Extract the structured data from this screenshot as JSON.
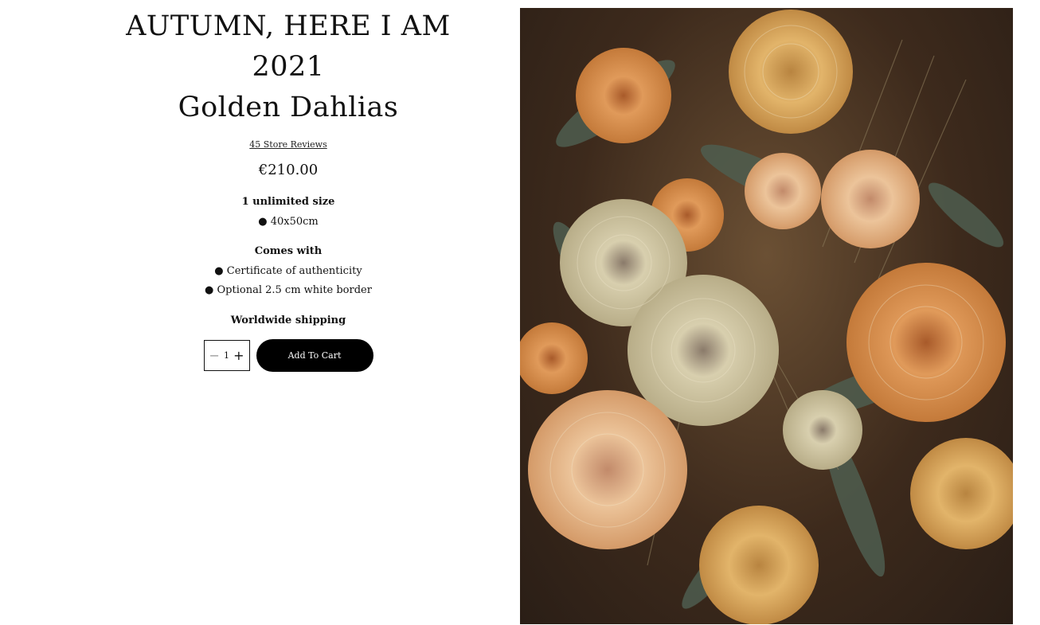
{
  "product": {
    "title_line1": "AUTUMN, HERE I AM 2021",
    "title_line2": "Golden Dahlias",
    "reviews_link": "45 Store Reviews",
    "price": "€210.00"
  },
  "details": {
    "size_heading": "1 unlimited size",
    "size_bullet": "● 40x50cm",
    "comes_with_heading": "Comes with",
    "comes_with_items": [
      "● Certificate of authenticity",
      "● Optional 2.5 cm white border"
    ],
    "shipping": "Worldwide shipping"
  },
  "cart": {
    "minus_glyph": "−",
    "quantity": "1",
    "plus_glyph": "+",
    "add_label": "Add To Cart"
  },
  "image": {
    "subject": "Still-life photograph of autumn dahlias in orange, peach and cream tones on a dark background",
    "colors": {
      "background": "#3d2a1c",
      "orange": "#d9873a",
      "peach": "#e8a878",
      "cream": "#e6dcbe",
      "leaf": "#5a6a58"
    }
  }
}
